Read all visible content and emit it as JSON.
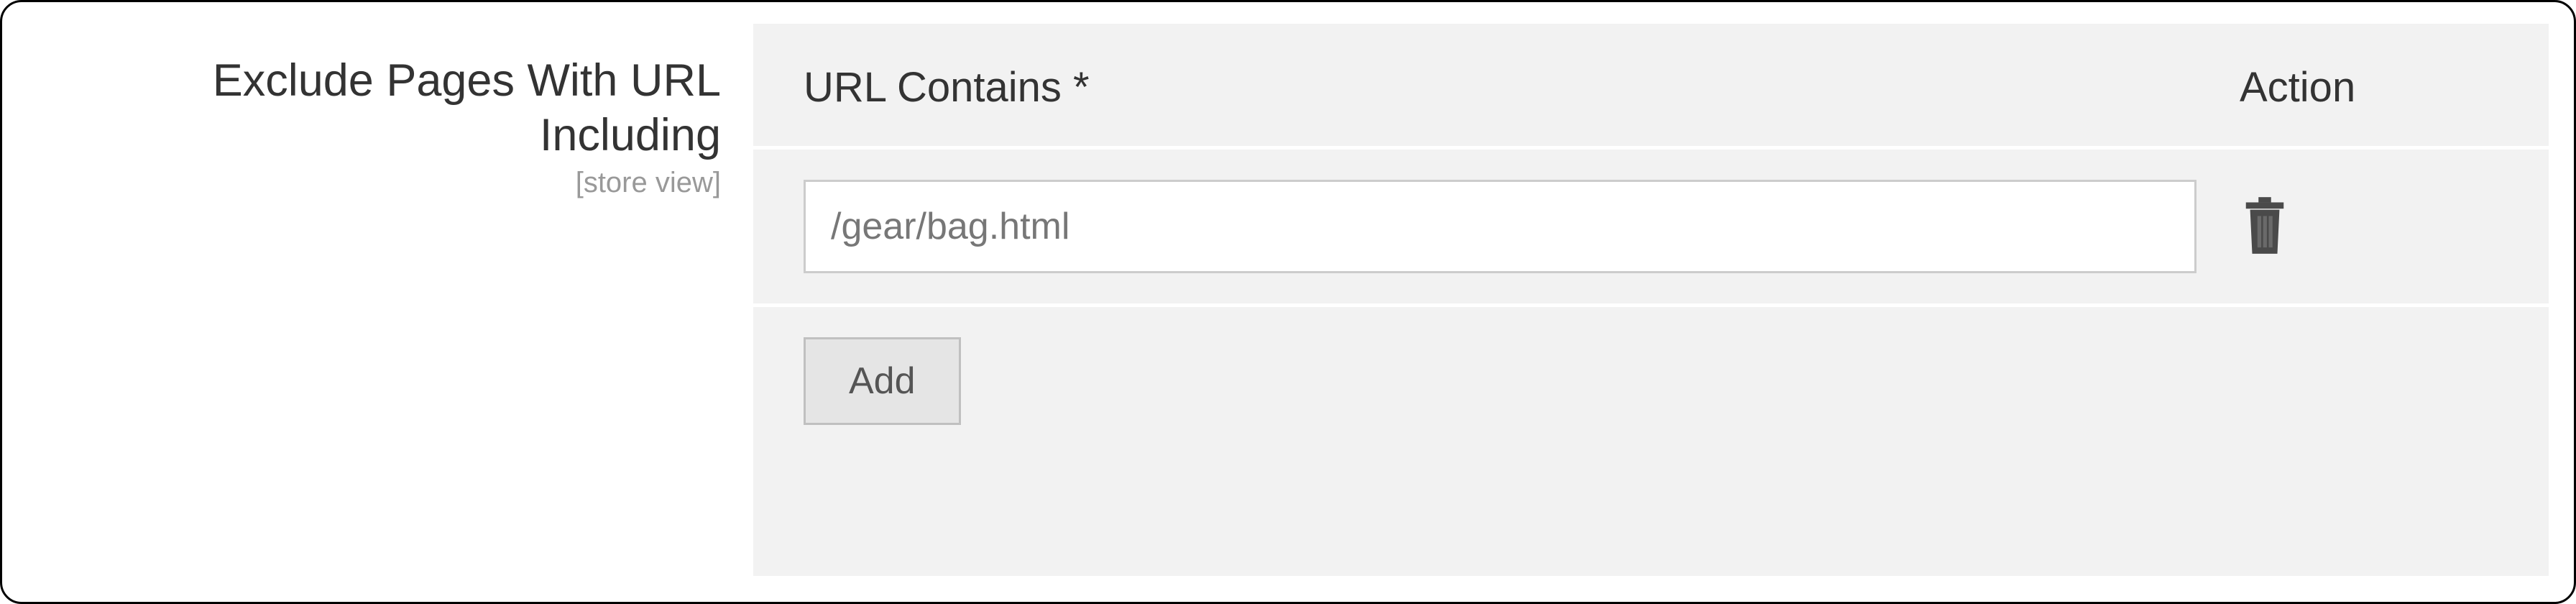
{
  "field": {
    "label": "Exclude Pages With URL Including",
    "scope": "[store view]"
  },
  "table": {
    "headers": {
      "url": "URL Contains *",
      "action": "Action"
    },
    "rows": [
      {
        "value": "/gear/bag.html"
      }
    ],
    "add_button_label": "Add"
  }
}
